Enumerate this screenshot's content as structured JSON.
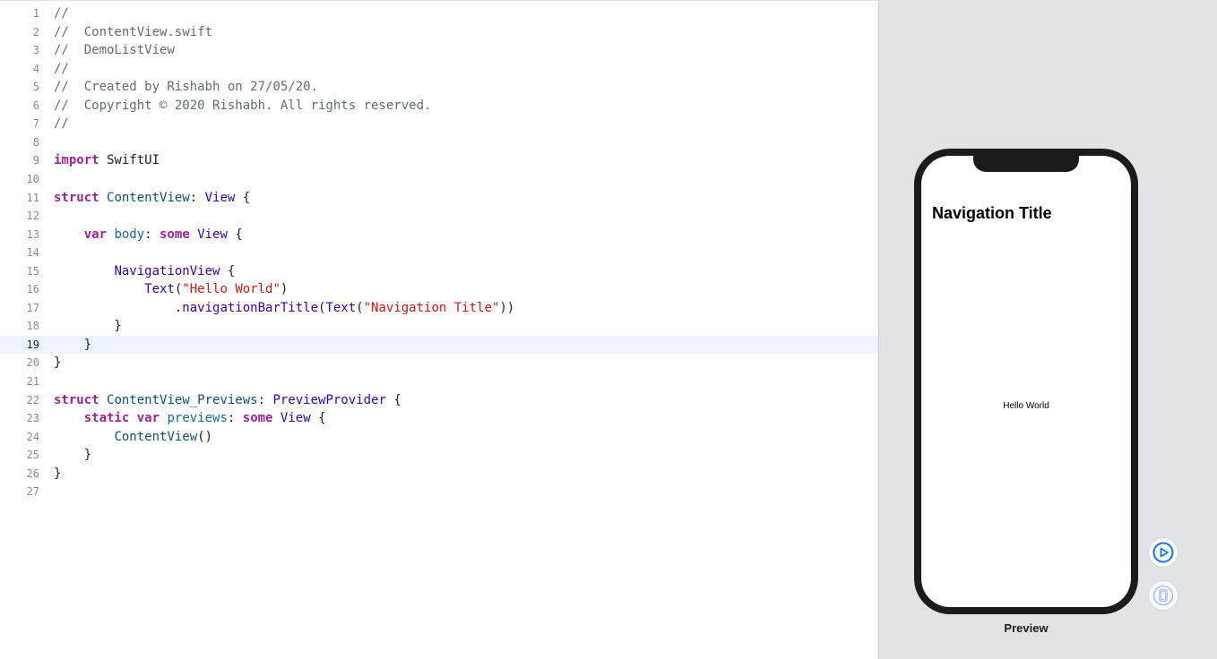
{
  "editor": {
    "active_line": 19,
    "lines": [
      {
        "num": "1",
        "tokens": [
          {
            "t": "//",
            "c": "comment"
          }
        ]
      },
      {
        "num": "2",
        "tokens": [
          {
            "t": "//  ContentView.swift",
            "c": "comment"
          }
        ]
      },
      {
        "num": "3",
        "tokens": [
          {
            "t": "//  DemoListView",
            "c": "comment"
          }
        ]
      },
      {
        "num": "4",
        "tokens": [
          {
            "t": "//",
            "c": "comment"
          }
        ]
      },
      {
        "num": "5",
        "tokens": [
          {
            "t": "//  Created by Rishabh on 27/05/20.",
            "c": "comment"
          }
        ]
      },
      {
        "num": "6",
        "tokens": [
          {
            "t": "//  Copyright © 2020 Rishabh. All rights reserved.",
            "c": "comment"
          }
        ]
      },
      {
        "num": "7",
        "tokens": [
          {
            "t": "//",
            "c": "comment"
          }
        ]
      },
      {
        "num": "8",
        "tokens": []
      },
      {
        "num": "9",
        "tokens": [
          {
            "t": "import",
            "c": "keyword"
          },
          {
            "t": " SwiftUI",
            "c": "plain"
          }
        ]
      },
      {
        "num": "10",
        "tokens": []
      },
      {
        "num": "11",
        "tokens": [
          {
            "t": "struct",
            "c": "keyword"
          },
          {
            "t": " ",
            "c": "plain"
          },
          {
            "t": "ContentView",
            "c": "type"
          },
          {
            "t": ": ",
            "c": "plain"
          },
          {
            "t": "View",
            "c": "sysType"
          },
          {
            "t": " {",
            "c": "plain"
          }
        ]
      },
      {
        "num": "12",
        "tokens": []
      },
      {
        "num": "13",
        "tokens": [
          {
            "t": "    ",
            "c": "plain"
          },
          {
            "t": "var",
            "c": "keyword"
          },
          {
            "t": " ",
            "c": "plain"
          },
          {
            "t": "body",
            "c": "prop"
          },
          {
            "t": ": ",
            "c": "plain"
          },
          {
            "t": "some",
            "c": "keyword"
          },
          {
            "t": " ",
            "c": "plain"
          },
          {
            "t": "View",
            "c": "sysType"
          },
          {
            "t": " {",
            "c": "plain"
          }
        ]
      },
      {
        "num": "14",
        "tokens": []
      },
      {
        "num": "15",
        "tokens": [
          {
            "t": "        ",
            "c": "plain"
          },
          {
            "t": "NavigationView",
            "c": "sysType"
          },
          {
            "t": " {",
            "c": "plain"
          }
        ]
      },
      {
        "num": "16",
        "tokens": [
          {
            "t": "            ",
            "c": "plain"
          },
          {
            "t": "Text",
            "c": "sysType"
          },
          {
            "t": "(",
            "c": "plain"
          },
          {
            "t": "\"Hello World\"",
            "c": "string"
          },
          {
            "t": ")",
            "c": "plain"
          }
        ]
      },
      {
        "num": "17",
        "tokens": [
          {
            "t": "                .",
            "c": "plain"
          },
          {
            "t": "navigationBarTitle",
            "c": "sysType"
          },
          {
            "t": "(",
            "c": "plain"
          },
          {
            "t": "Text",
            "c": "sysType"
          },
          {
            "t": "(",
            "c": "plain"
          },
          {
            "t": "\"Navigation Title\"",
            "c": "string"
          },
          {
            "t": "))",
            "c": "plain"
          }
        ]
      },
      {
        "num": "18",
        "tokens": [
          {
            "t": "        }",
            "c": "plain"
          }
        ]
      },
      {
        "num": "19",
        "tokens": [
          {
            "t": "    }",
            "c": "plain"
          }
        ]
      },
      {
        "num": "20",
        "tokens": [
          {
            "t": "}",
            "c": "plain"
          }
        ]
      },
      {
        "num": "21",
        "tokens": []
      },
      {
        "num": "22",
        "tokens": [
          {
            "t": "struct",
            "c": "keyword"
          },
          {
            "t": " ",
            "c": "plain"
          },
          {
            "t": "ContentView_Previews",
            "c": "type"
          },
          {
            "t": ": ",
            "c": "plain"
          },
          {
            "t": "PreviewProvider",
            "c": "sysType"
          },
          {
            "t": " {",
            "c": "plain"
          }
        ]
      },
      {
        "num": "23",
        "tokens": [
          {
            "t": "    ",
            "c": "plain"
          },
          {
            "t": "static",
            "c": "keyword"
          },
          {
            "t": " ",
            "c": "plain"
          },
          {
            "t": "var",
            "c": "keyword"
          },
          {
            "t": " ",
            "c": "plain"
          },
          {
            "t": "previews",
            "c": "prop"
          },
          {
            "t": ": ",
            "c": "plain"
          },
          {
            "t": "some",
            "c": "keyword"
          },
          {
            "t": " ",
            "c": "plain"
          },
          {
            "t": "View",
            "c": "sysType"
          },
          {
            "t": " {",
            "c": "plain"
          }
        ]
      },
      {
        "num": "24",
        "tokens": [
          {
            "t": "        ",
            "c": "plain"
          },
          {
            "t": "ContentView",
            "c": "type"
          },
          {
            "t": "()",
            "c": "plain"
          }
        ]
      },
      {
        "num": "25",
        "tokens": [
          {
            "t": "    }",
            "c": "plain"
          }
        ]
      },
      {
        "num": "26",
        "tokens": [
          {
            "t": "}",
            "c": "plain"
          }
        ]
      },
      {
        "num": "27",
        "tokens": []
      }
    ]
  },
  "preview": {
    "nav_title": "Navigation Title",
    "body_text": "Hello World",
    "label": "Preview",
    "buttons": [
      {
        "icon": "play-circle-icon",
        "color": "#1a73e8"
      },
      {
        "icon": "device-icon",
        "color": "#9cc1ef"
      }
    ]
  },
  "colors": {
    "pane_background": "#e2e3e7",
    "active_line_highlight": "#ecf5fe",
    "device_frame": "#1b1b1b"
  }
}
